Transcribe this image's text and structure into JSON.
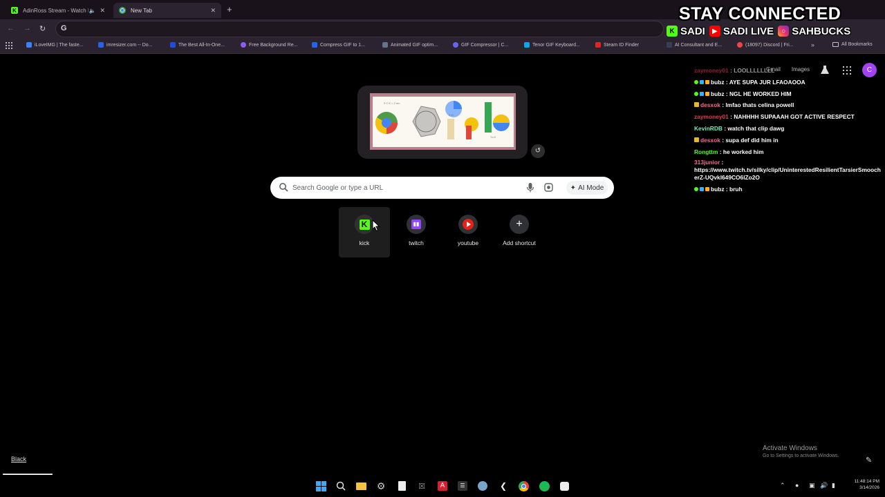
{
  "browser": {
    "tabs": [
      {
        "title": "AdinRoss Stream - Watch L",
        "favicon": "kick-icon",
        "active": false
      },
      {
        "title": "New Tab",
        "favicon": "chrome-icon",
        "active": true
      }
    ],
    "omnibox_value": "",
    "bookmarks": [
      {
        "label": "iLoveIMG | The faste...",
        "color": "#3b82f6"
      },
      {
        "label": "imresizer.com -- Do...",
        "color": "#2563eb"
      },
      {
        "label": "The Best All-In-One...",
        "color": "#1d4ed8"
      },
      {
        "label": "Free Background Re...",
        "color": "#8b5cf6"
      },
      {
        "label": "Compress GIF to 1...",
        "color": "#2563eb"
      },
      {
        "label": "Animated GIF optim...",
        "color": "#64748b"
      },
      {
        "label": "GIF Compressor | C...",
        "color": "#6366f1"
      },
      {
        "label": "Tenor GIF Keyboard...",
        "color": "#0ea5e9"
      },
      {
        "label": "Steam ID Finder",
        "color": "#dc2626"
      },
      {
        "label": "AI Consultant and E...",
        "color": "#334155"
      },
      {
        "label": "(18097) Discord | Fri...",
        "color": "#ef4444"
      }
    ],
    "all_bookmarks": "All Bookmarks"
  },
  "overlay": {
    "headline": "STAY CONNECTED",
    "socials": [
      {
        "icon": "kick-icon",
        "handle": "SADI"
      },
      {
        "icon": "youtube-icon",
        "handle": "SADI LIVE"
      },
      {
        "icon": "instagram-icon",
        "handle": "SAHBUCKS"
      }
    ]
  },
  "google": {
    "links": [
      "Gmail",
      "Images"
    ],
    "profile_initial": "C",
    "search_placeholder": "Search Google or type a URL",
    "ai_mode": "AI Mode",
    "shortcuts": [
      {
        "label": "kick"
      },
      {
        "label": "twitch"
      },
      {
        "label": "youtube"
      },
      {
        "label": "Add shortcut"
      }
    ]
  },
  "chat": [
    {
      "user": "zaymoney01",
      "text": "LOOLLLLLLLL",
      "color": "#e8384f",
      "badges": []
    },
    {
      "user": "bubz",
      "text": "AYE SUPA JUR LFAOAOOA",
      "color": "#ffffff",
      "badges": [
        "b1",
        "b2",
        "b3"
      ]
    },
    {
      "user": "bubz",
      "text": "NGL HE WORKED HIM",
      "color": "#ffffff",
      "badges": [
        "b1",
        "b2",
        "b3"
      ]
    },
    {
      "user": "desxok",
      "text": "lmfao thats celina powell",
      "color": "#f36c8c",
      "badges": [
        "sq"
      ]
    },
    {
      "user": "zaymoney01",
      "text": "NAHHHH SUPAAAH GOT ACTIVE RESPECT",
      "color": "#e8384f",
      "badges": []
    },
    {
      "user": "KevinRDB",
      "text": "watch that clip dawg",
      "color": "#7be8b8",
      "badges": []
    },
    {
      "user": "desxok",
      "text": "supa def did him in",
      "color": "#f36c8c",
      "badges": [
        "sq"
      ]
    },
    {
      "user": "Rongttm",
      "text": "he worked him",
      "color": "#53fc18",
      "badges": []
    },
    {
      "user": "313junior",
      "text": "https://www.twitch.tv/silky/clip/UninterestedResilientTarsierSmoocherZ-UQvkl649CO6lZo2O",
      "color": "#f36c8c",
      "badges": [],
      "wrap": true
    },
    {
      "user": "bubz",
      "text": "bruh",
      "color": "#ffffff",
      "badges": [
        "b1",
        "b2",
        "b3"
      ]
    }
  ],
  "windows": {
    "activate_title": "Activate Windows",
    "activate_sub": "Go to Settings to activate Windows.",
    "black_link": "Black",
    "clock_time": "11:48:14 PM",
    "clock_date": "3/14/2026"
  }
}
